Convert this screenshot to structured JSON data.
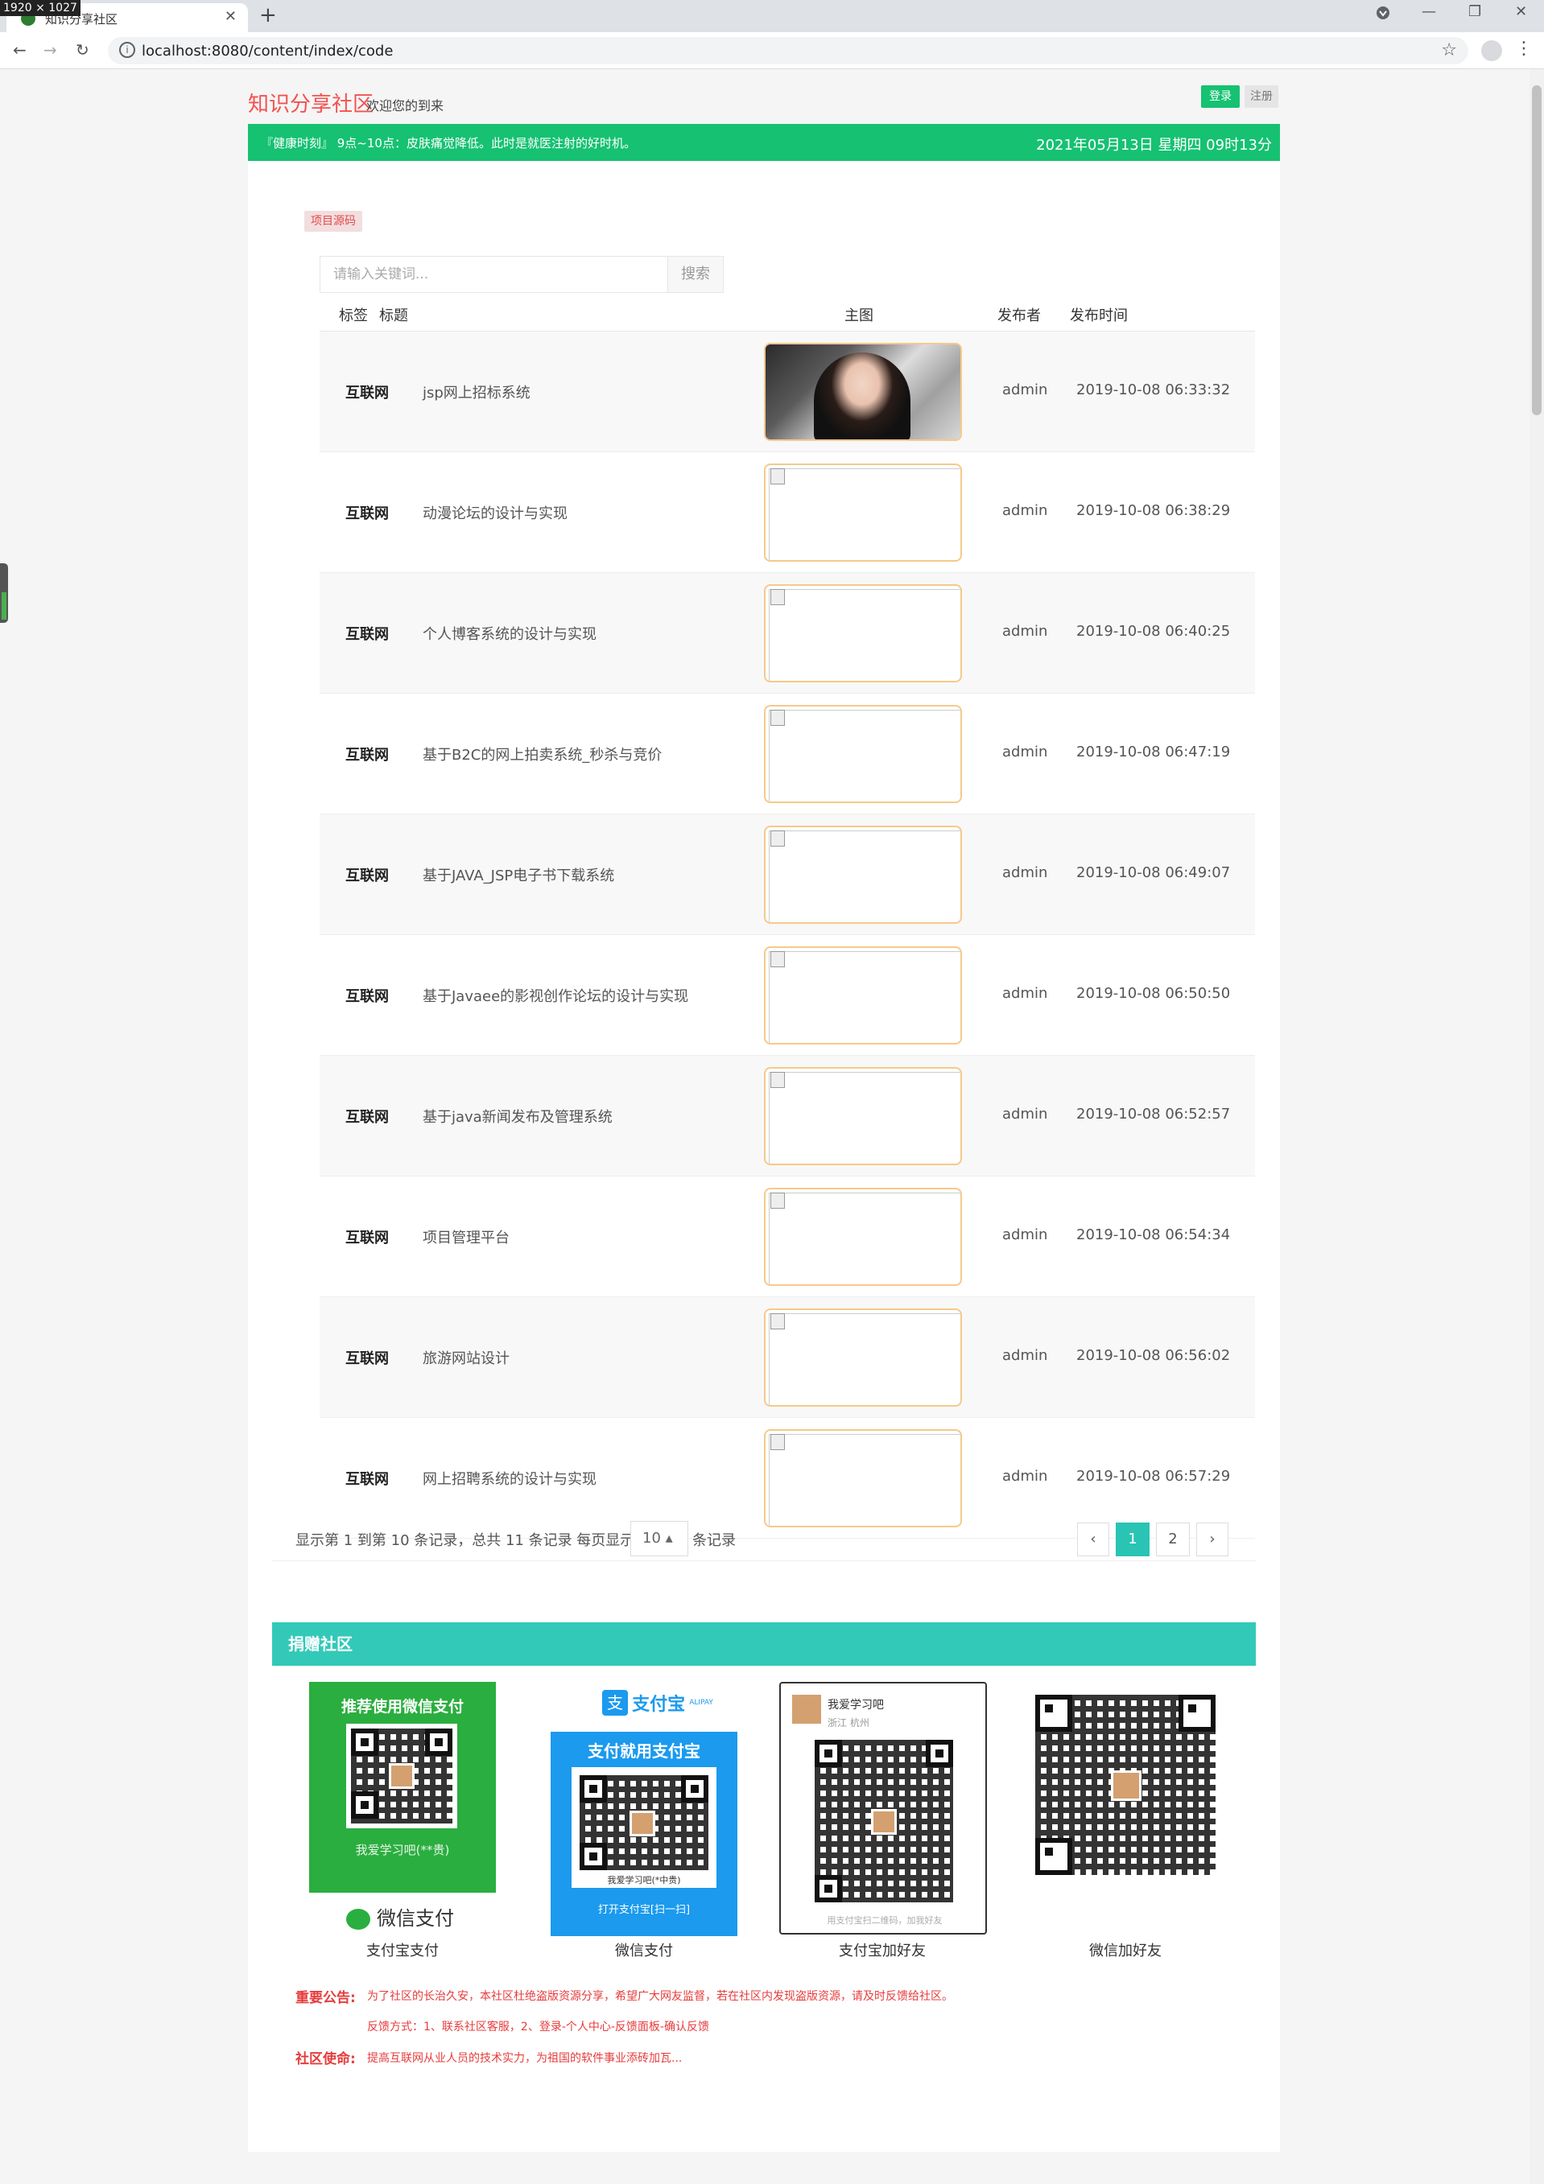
{
  "browser": {
    "size_badge": "1920 × 1027",
    "tab_title": "知识分享社区",
    "new_tab": "+",
    "url": "localhost:8080/content/index/code",
    "close": "✕",
    "back": "←",
    "forward": "→",
    "reload": "↻",
    "star": "☆",
    "menu": "⋮",
    "minimize": "—",
    "restore": "❐",
    "win_close": "✕"
  },
  "header": {
    "logo": "知识分享社区",
    "welcome": "欢迎您的到来",
    "login": "登录",
    "register": "注册"
  },
  "health": {
    "text": "『健康时刻』 9点~10点：皮肤痛觉降低。此时是就医注射的好时机。",
    "datetime": "2021年05月13日 星期四 09时13分"
  },
  "section": {
    "tag": "项目源码",
    "search_placeholder": "请输入关键词...",
    "search_button": "搜索"
  },
  "table": {
    "headers": [
      "标签",
      "标题",
      "主图",
      "发布者",
      "发布时间"
    ],
    "rows": [
      {
        "tag": "互联网",
        "title": "jsp网上招标系统",
        "author": "admin",
        "time": "2019-10-08 06:33:32"
      },
      {
        "tag": "互联网",
        "title": "动漫论坛的设计与实现",
        "author": "admin",
        "time": "2019-10-08 06:38:29"
      },
      {
        "tag": "互联网",
        "title": "个人博客系统的设计与实现",
        "author": "admin",
        "time": "2019-10-08 06:40:25"
      },
      {
        "tag": "互联网",
        "title": "基于B2C的网上拍卖系统_秒杀与竞价",
        "author": "admin",
        "time": "2019-10-08 06:47:19"
      },
      {
        "tag": "互联网",
        "title": "基于JAVA_JSP电子书下载系统",
        "author": "admin",
        "time": "2019-10-08 06:49:07"
      },
      {
        "tag": "互联网",
        "title": "基于Javaee的影视创作论坛的设计与实现",
        "author": "admin",
        "time": "2019-10-08 06:50:50"
      },
      {
        "tag": "互联网",
        "title": "基于java新闻发布及管理系统",
        "author": "admin",
        "time": "2019-10-08 06:52:57"
      },
      {
        "tag": "互联网",
        "title": "项目管理平台",
        "author": "admin",
        "time": "2019-10-08 06:54:34"
      },
      {
        "tag": "互联网",
        "title": "旅游网站设计",
        "author": "admin",
        "time": "2019-10-08 06:56:02"
      },
      {
        "tag": "互联网",
        "title": "网上招聘系统的设计与实现",
        "author": "admin",
        "time": "2019-10-08 06:57:29"
      }
    ]
  },
  "pagination": {
    "info": "显示第 1 到第 10 条记录，总共 11 条记录  每页显示",
    "page_size": "10 ▴",
    "suffix": "条记录",
    "prev": "‹",
    "pages": [
      "1",
      "2"
    ],
    "next": "›"
  },
  "donate": {
    "title": "捐赠社区",
    "wechat_card_title": "推荐使用微信支付",
    "wechat_card_sub": "我爱学习吧(**贵)",
    "wechat_brand": "微信支付",
    "caption_1": "支付宝支付",
    "alipay_brand": "支付宝",
    "alipay_brand_en": "ALIPAY",
    "alipay_card_title": "支付就用支付宝",
    "alipay_card_sub": "我爱学习吧(*中贵)",
    "alipay_card_scan": "打开支付宝[扫一扫]",
    "caption_2": "微信支付",
    "friend_name": "我爱学习吧",
    "friend_loc": "浙江 杭州",
    "friend_foot": "用支付宝扫二维码，加我好友",
    "caption_3": "支付宝加好友",
    "caption_4": "微信加好友"
  },
  "notice": {
    "label_1": "重要公告:",
    "text_1": "为了社区的长治久安，本社区杜绝盗版资源分享，希望广大网友监督，若在社区内发现盗版资源，请及时反馈给社区。",
    "text_2": "反馈方式：1、联系社区客服，2、登录-个人中心-反馈面板-确认反馈",
    "label_2": "社区使命:",
    "text_3": "提高互联网从业人员的技术实力，为祖国的软件事业添砖加瓦..."
  },
  "colors": {
    "brand_green": "#16c172",
    "logo_red": "#f55151",
    "teal": "#32c9b8",
    "wechat_green": "#2aae3f",
    "alipay_blue": "#1b9aee"
  }
}
